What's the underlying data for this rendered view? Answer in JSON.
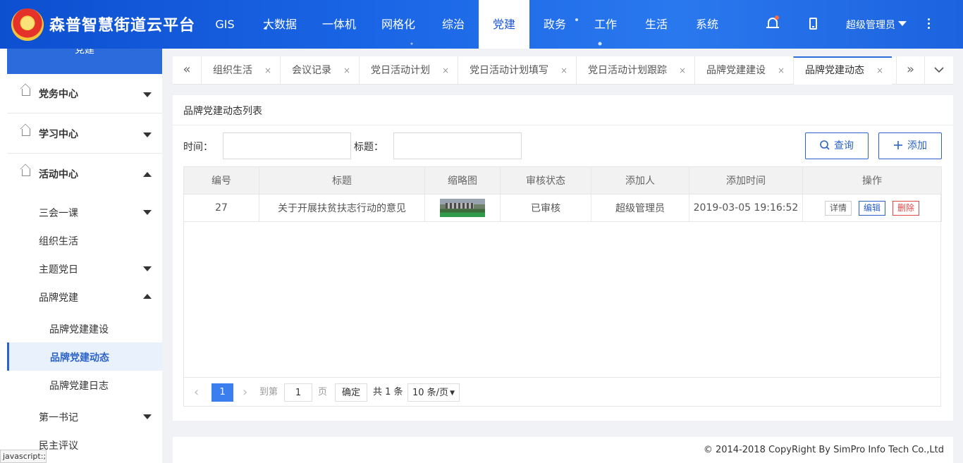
{
  "header": {
    "brand": "森普智慧街道云平台",
    "nav": [
      "GIS",
      "大数据",
      "一体机",
      "网格化",
      "综治",
      "党建",
      "政务",
      "工作",
      "生活",
      "系统"
    ],
    "active_nav": "党建",
    "user": "超级管理员"
  },
  "sidebar": {
    "top_label": "党建",
    "groups": [
      "党务中心",
      "学习中心",
      "活动中心"
    ],
    "items": [
      "三会一课",
      "组织生活",
      "主题党日",
      "品牌党建",
      "品牌党建建设",
      "品牌党建动态",
      "品牌党建日志",
      "第一书记",
      "民主评议"
    ],
    "active_item": "品牌党建动态"
  },
  "tabs": {
    "items": [
      "组织生活",
      "会议记录",
      "党日活动计划",
      "党日活动计划填写",
      "党日活动计划跟踪",
      "品牌党建建设",
      "品牌党建动态"
    ],
    "close": "×",
    "prev": "«",
    "next": "»",
    "dropdown": "⌄"
  },
  "card": {
    "title": "品牌党建动态列表",
    "filter_time_label": "时间：",
    "filter_title_label": "标题：",
    "search_button": "查询",
    "add_button": "添加"
  },
  "table": {
    "headers": [
      "编号",
      "标题",
      "缩略图",
      "审核状态",
      "添加人",
      "添加时间",
      "操作"
    ],
    "rows": [
      {
        "id": "27",
        "title": "关于开展扶贫扶志行动的意见",
        "status": "已审核",
        "creator": "超级管理员",
        "time": "2019-03-05 19:16:52",
        "actions": [
          "详情",
          "编辑",
          "删除"
        ]
      }
    ]
  },
  "pager": {
    "prev": "‹",
    "current": "1",
    "next": "›",
    "goto_label": "到第",
    "goto_value": "1",
    "page_unit": "页",
    "confirm": "确定",
    "total": "共 1 条",
    "page_size": "10 条/页"
  },
  "footer": {
    "copyright": "© 2014-2018 CopyRight By SimPro Info Tech Co.,Ltd"
  },
  "statusbar": "javascript:;",
  "colors": {
    "header_blue": "#1a66e6",
    "accent": "#2b63c8",
    "status_approved": "#e07b26",
    "delete": "#e04848"
  }
}
